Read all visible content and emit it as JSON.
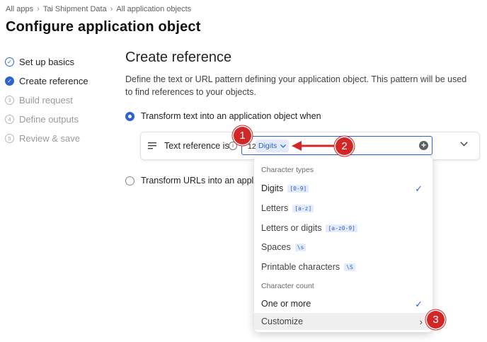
{
  "breadcrumbs": [
    "All apps",
    "Tai Shipment Data",
    "All application objects"
  ],
  "page_title": "Configure application object",
  "steps": [
    {
      "label": "Set up basics",
      "state": "done"
    },
    {
      "label": "Create reference",
      "state": "current"
    },
    {
      "label": "Build request",
      "state": "todo",
      "num": "3"
    },
    {
      "label": "Define outputs",
      "state": "todo",
      "num": "4"
    },
    {
      "label": "Review & save",
      "state": "todo",
      "num": "5"
    }
  ],
  "main": {
    "heading": "Create reference",
    "description": "Define the text or URL pattern defining your application object. This pattern will be used to find references to your objects.",
    "option_text": "Transform text into an application object when",
    "option_url": "Transform URLs into an applica",
    "text_reference_label": "Text reference is",
    "chip_count": "12",
    "chip_label": "Digits"
  },
  "dropdown": {
    "character_types_header": "Character types",
    "items": [
      {
        "label": "Digits",
        "code": "[0-9]",
        "selected": true
      },
      {
        "label": "Letters",
        "code": "[a-z]",
        "selected": false
      },
      {
        "label": "Letters or digits",
        "code": "[a-z0-9]",
        "selected": false
      },
      {
        "label": "Spaces",
        "code": "\\s",
        "selected": false
      },
      {
        "label": "Printable characters",
        "code": "\\S",
        "selected": false
      }
    ],
    "character_count_header": "Character count",
    "count_items": [
      {
        "label": "One or more",
        "selected": true
      },
      {
        "label": "Customize",
        "submenu": true
      }
    ]
  },
  "annotations": [
    "1",
    "2",
    "3"
  ],
  "colors": {
    "accent": "#2f63d1",
    "annotation": "#d32626"
  }
}
